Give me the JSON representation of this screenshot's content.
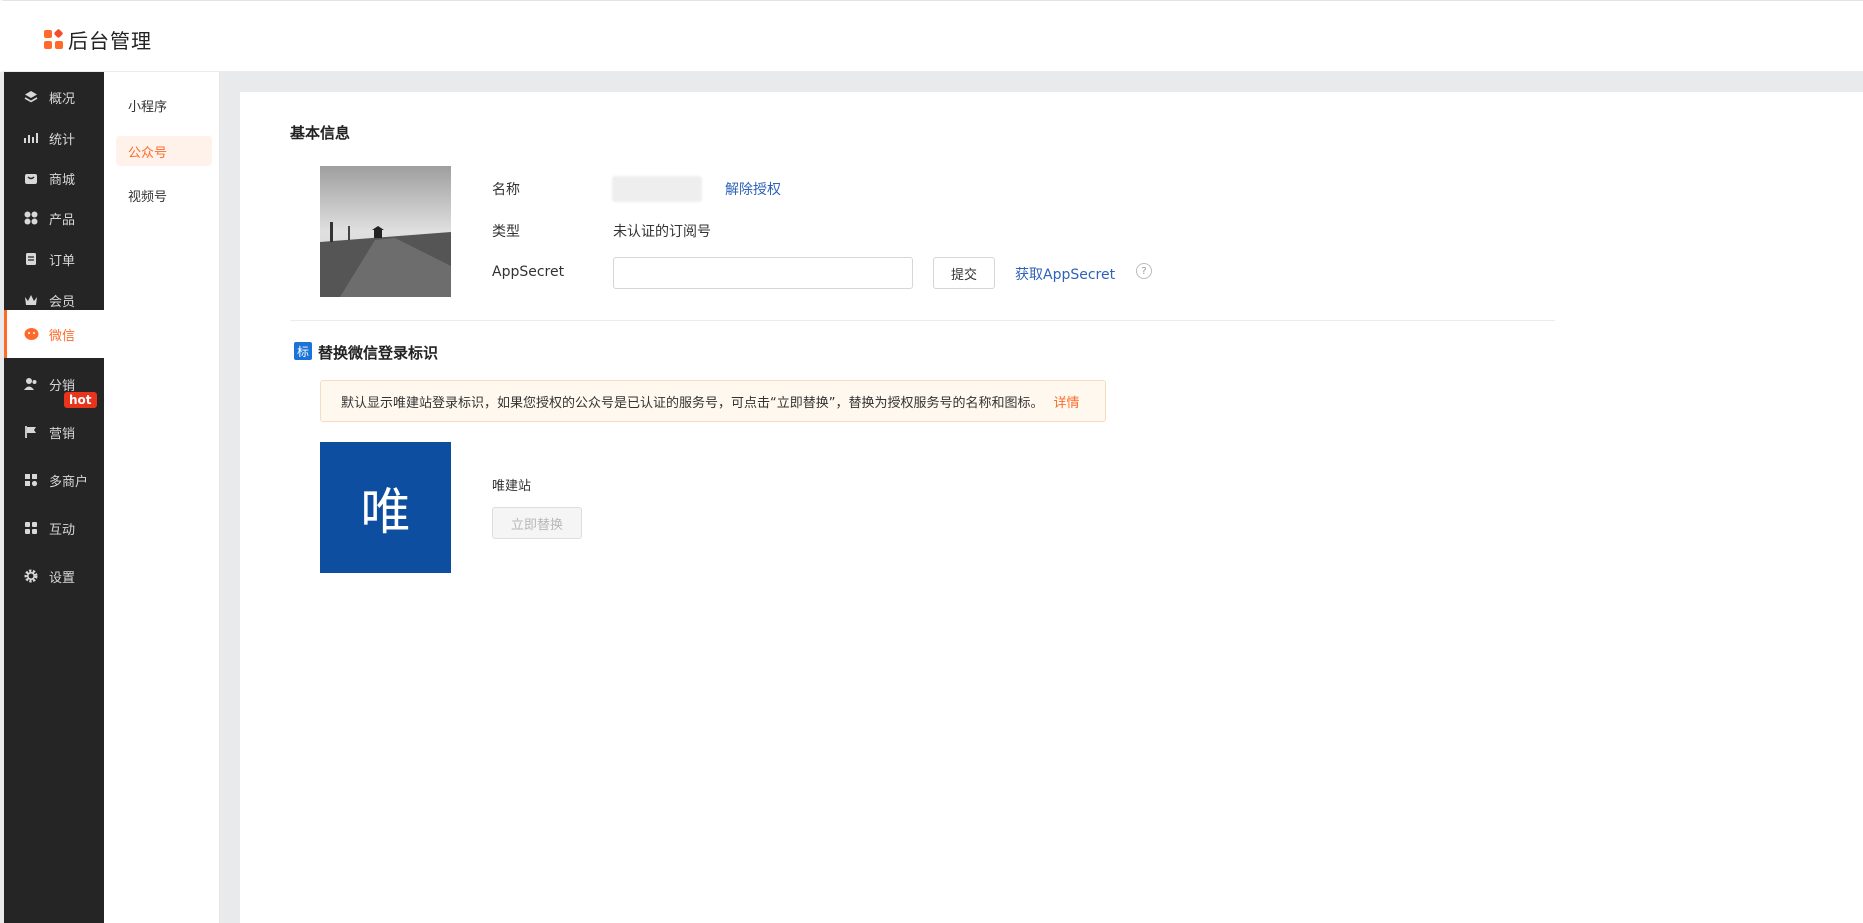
{
  "app": {
    "title": "后台管理"
  },
  "sidebar": {
    "items": [
      {
        "label": "概况",
        "icon": "layers-icon"
      },
      {
        "label": "统计",
        "icon": "chart-icon"
      },
      {
        "label": "商城",
        "icon": "bag-icon"
      },
      {
        "label": "产品",
        "icon": "grid-icon"
      },
      {
        "label": "订单",
        "icon": "clipboard-icon"
      },
      {
        "label": "会员",
        "icon": "crown-icon"
      },
      {
        "label": "微信",
        "icon": "wechat-icon",
        "active": true
      },
      {
        "label": "分销",
        "icon": "users-icon"
      },
      {
        "label": "营销",
        "icon": "flag-icon",
        "badge": "hot"
      },
      {
        "label": "多商户",
        "icon": "store-icon"
      },
      {
        "label": "互动",
        "icon": "apps-icon"
      },
      {
        "label": "设置",
        "icon": "gear-icon"
      }
    ]
  },
  "subnav": {
    "items": [
      {
        "label": "小程序"
      },
      {
        "label": "公众号",
        "active": true
      },
      {
        "label": "视频号"
      }
    ]
  },
  "basic": {
    "title": "基本信息",
    "name_label": "名称",
    "unbind_link": "解除授权",
    "type_label": "类型",
    "type_value": "未认证的订阅号",
    "secret_label": "AppSecret",
    "secret_value": "",
    "submit": "提交",
    "get_secret_link": "获取AppSecret",
    "help": "?"
  },
  "replace": {
    "icon_text": "标",
    "title": "替换微信登录标识",
    "notice": "默认显示唯建站登录标识，如果您授权的公众号是已认证的服务号，可点击“立即替换”，替换为授权服务号的名称和图标。",
    "notice_link": "详情",
    "logo_char": "唯",
    "site_name": "唯建站",
    "replace_button": "立即替换"
  },
  "colors": {
    "accent": "#ff6a2b",
    "link": "#2f62b8",
    "sidebar": "#252525",
    "logo_tile": "#0d4ea1"
  }
}
